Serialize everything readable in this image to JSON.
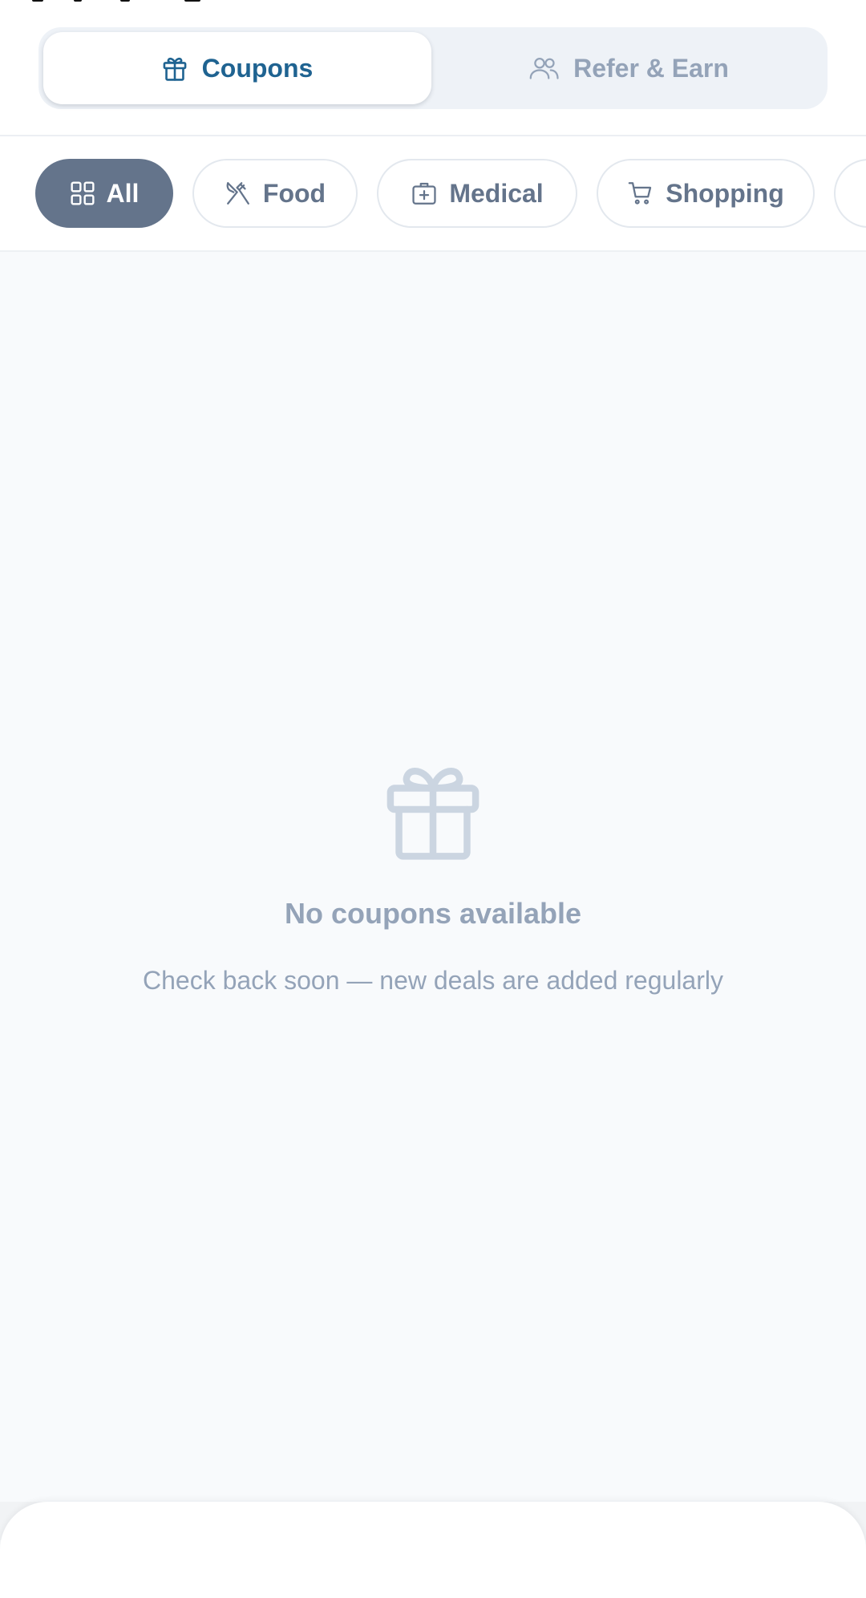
{
  "tabs": {
    "coupons_label": "Coupons",
    "refer_label": "Refer & Earn",
    "active": "coupons"
  },
  "categories": [
    {
      "label": "All",
      "icon": "grid-icon",
      "active": true
    },
    {
      "label": "Food",
      "icon": "utensils-icon",
      "active": false
    },
    {
      "label": "Medical",
      "icon": "medical-kit-icon",
      "active": false
    },
    {
      "label": "Shopping",
      "icon": "cart-icon",
      "active": false
    }
  ],
  "empty_state": {
    "icon": "gift-icon",
    "title": "No coupons available",
    "subtitle": "Check back soon — new deals are added regularly"
  },
  "colors": {
    "accent": "#1f6391",
    "chip_active": "#64748b",
    "muted_text": "#94a3b8",
    "page_background": "#f8fafc"
  }
}
